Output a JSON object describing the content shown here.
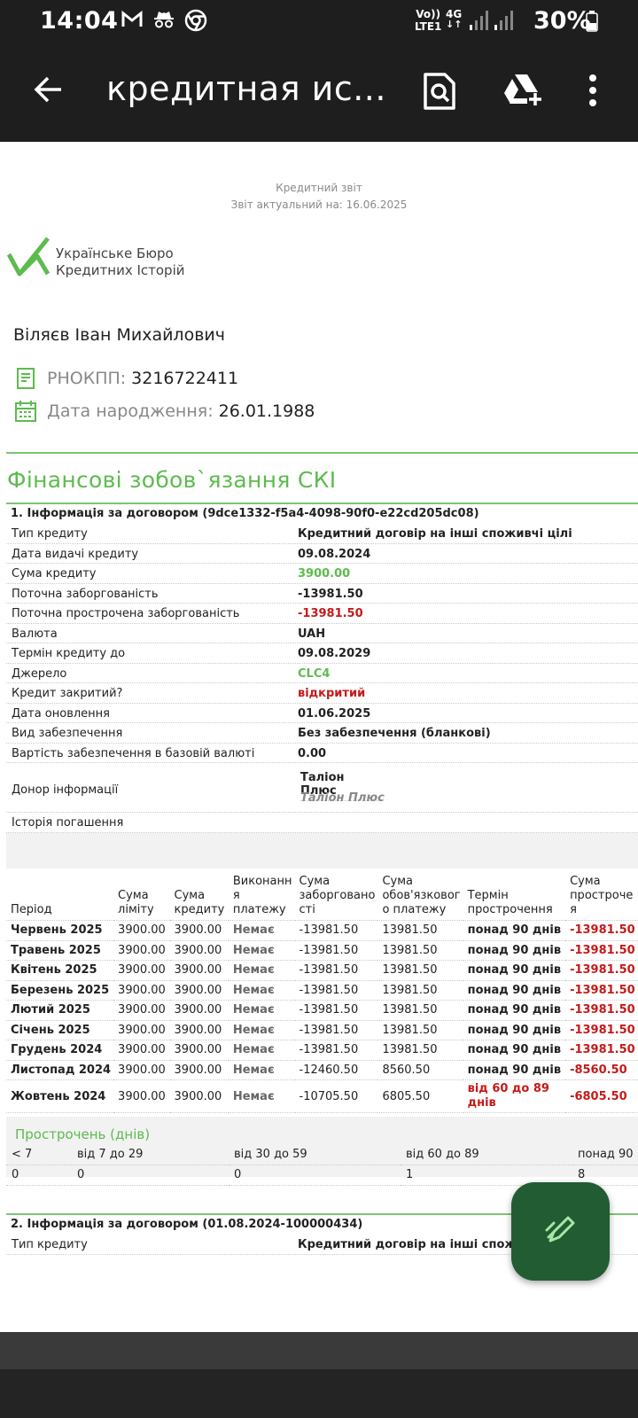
{
  "status_bar": {
    "time": "14:04",
    "network_top": "Vo))",
    "network_bottom": "LTE1",
    "network_type": "4G",
    "battery": "30%",
    "icons": [
      "gmail-icon",
      "incognito-icon",
      "chrome-icon",
      "signal-icon",
      "signal-icon",
      "battery-icon"
    ]
  },
  "app_bar": {
    "title": "кредитная ис...",
    "icons": [
      "back-arrow-icon",
      "find-in-page-icon",
      "add-to-drive-icon",
      "more-vert-icon"
    ]
  },
  "report": {
    "header_line1": "Кредитний звіт",
    "header_line2": "Звіт актуальний на: 16.06.2025",
    "logo_line1": "Українське Бюро",
    "logo_line2": "Кредитних Історій",
    "person_name": "Віляєв Іван Михайлович",
    "tax_id_label": "РНОКПП:",
    "tax_id_value": "3216722411",
    "birth_label": "Дата народження:",
    "birth_value": "26.01.1988",
    "section_title": "Фінансові зобов`язання СКІ"
  },
  "contract1": {
    "heading": "1. Інформація за договором (9dce1332-f5a4-4098-90f0-e22cd205dc08)",
    "rows": [
      {
        "label": "Тип кредиту",
        "value": "Кредитний договір на інші споживчі цілі",
        "style": ""
      },
      {
        "label": "Дата видачі кредиту",
        "value": "09.08.2024",
        "style": ""
      },
      {
        "label": "Сума кредиту",
        "value": "3900.00",
        "style": "green"
      },
      {
        "label": "Поточна заборгованість",
        "value": "-13981.50",
        "style": ""
      },
      {
        "label": "Поточна прострочена заборгованість",
        "value": "-13981.50",
        "style": "red"
      },
      {
        "label": "Валюта",
        "value": "UAH",
        "style": ""
      },
      {
        "label": "Термін кредиту до",
        "value": "09.08.2029",
        "style": ""
      },
      {
        "label": "Джерело",
        "value": "CLC4",
        "style": "green"
      },
      {
        "label": "Кредит закритий?",
        "value": "відкритий",
        "style": "red"
      },
      {
        "label": "Дата оновлення",
        "value": "01.06.2025",
        "style": ""
      },
      {
        "label": "Вид забезпечення",
        "value": "Без забезпечення (бланкові)",
        "style": ""
      },
      {
        "label": "Вартість забезпечення в базовій валюті",
        "value": "0.00",
        "style": ""
      }
    ],
    "donor_label": "Донор інформації",
    "donor_value1": "Таліон Плюс",
    "donor_value2": "Таліон Плюс",
    "history_label": "Історія погашення",
    "history_headers": [
      "Період",
      "Сума ліміту",
      "Сума кредиту",
      "Виконанн я платежу",
      "Сума заборговано сті",
      "Сума обов'язковог о платежу",
      "Термін прострочення",
      "Сума простроче я"
    ],
    "history_rows": [
      {
        "period": "Червень 2025",
        "limit": "3900.00",
        "credit": "3900.00",
        "payment": "Немає",
        "debt": "-13981.50",
        "mandatory": "13981.50",
        "term": "понад 90 днів",
        "overdue": "-13981.50",
        "term_red": false
      },
      {
        "period": "Травень 2025",
        "limit": "3900.00",
        "credit": "3900.00",
        "payment": "Немає",
        "debt": "-13981.50",
        "mandatory": "13981.50",
        "term": "понад 90 днів",
        "overdue": "-13981.50",
        "term_red": false
      },
      {
        "period": "Квітень 2025",
        "limit": "3900.00",
        "credit": "3900.00",
        "payment": "Немає",
        "debt": "-13981.50",
        "mandatory": "13981.50",
        "term": "понад 90 днів",
        "overdue": "-13981.50",
        "term_red": false
      },
      {
        "period": "Березень 2025",
        "limit": "3900.00",
        "credit": "3900.00",
        "payment": "Немає",
        "debt": "-13981.50",
        "mandatory": "13981.50",
        "term": "понад 90 днів",
        "overdue": "-13981.50",
        "term_red": false
      },
      {
        "period": "Лютий 2025",
        "limit": "3900.00",
        "credit": "3900.00",
        "payment": "Немає",
        "debt": "-13981.50",
        "mandatory": "13981.50",
        "term": "понад 90 днів",
        "overdue": "-13981.50",
        "term_red": false
      },
      {
        "period": "Січень 2025",
        "limit": "3900.00",
        "credit": "3900.00",
        "payment": "Немає",
        "debt": "-13981.50",
        "mandatory": "13981.50",
        "term": "понад 90 днів",
        "overdue": "-13981.50",
        "term_red": false
      },
      {
        "period": "Грудень 2024",
        "limit": "3900.00",
        "credit": "3900.00",
        "payment": "Немає",
        "debt": "-13981.50",
        "mandatory": "13981.50",
        "term": "понад 90 днів",
        "overdue": "-13981.50",
        "term_red": false
      },
      {
        "period": "Листопад 2024",
        "limit": "3900.00",
        "credit": "3900.00",
        "payment": "Немає",
        "debt": "-12460.50",
        "mandatory": "8560.50",
        "term": "понад 90 днів",
        "overdue": "-8560.50",
        "term_red": false
      },
      {
        "period": "Жовтень 2024",
        "limit": "3900.00",
        "credit": "3900.00",
        "payment": "Немає",
        "debt": "-10705.50",
        "mandatory": "6805.50",
        "term": "від 60 до 89 днів",
        "overdue": "-6805.50",
        "term_red": true
      }
    ],
    "overdue_title": "Прострочень (днів)",
    "overdue_headers": [
      "< 7",
      "від 7 до 29",
      "від 30 до 59",
      "від 60 до 89",
      "понад 90"
    ],
    "overdue_values": [
      "0",
      "0",
      "0",
      "1",
      "8"
    ]
  },
  "contract2": {
    "heading": "2. Інформація за договором (01.08.2024-100000434)",
    "row_label": "Тип кредиту",
    "row_value": "Кредитний договір на інші споживчі цілі"
  },
  "colors": {
    "bar_bg": "#1e1e1e",
    "accent_green": "#5dbb4e",
    "alert_red": "#c61a1a",
    "fab_bg": "#215c32"
  }
}
